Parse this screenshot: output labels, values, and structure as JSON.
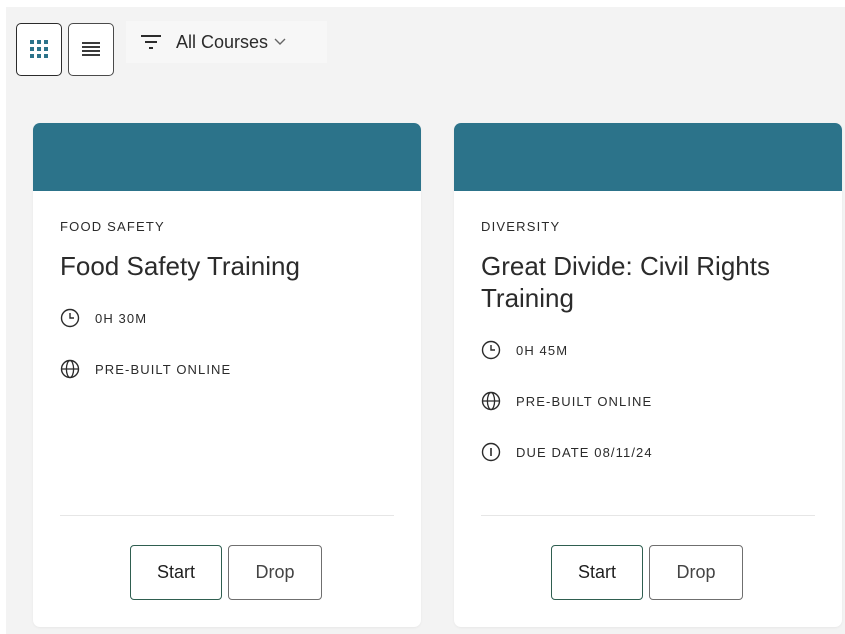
{
  "toolbar": {
    "grid_view_icon": "grid-dots-icon",
    "list_view_icon": "list-lines-icon",
    "filter": {
      "icon": "filter-icon",
      "label": "All Courses",
      "chevron_icon": "chevron-down-icon"
    }
  },
  "colors": {
    "banner": "#2c738a",
    "background": "#f3f3f3",
    "card": "#ffffff",
    "start_border": "#2f5e50"
  },
  "courses": [
    {
      "category": "FOOD SAFETY",
      "title": "Food Safety Training",
      "duration": "0H 30M",
      "format": "PRE-BUILT ONLINE",
      "start_label": "Start",
      "drop_label": "Drop"
    },
    {
      "category": "DIVERSITY",
      "title": "Great Divide: Civil Rights Training",
      "duration": "0H 45M",
      "format": "PRE-BUILT ONLINE",
      "due": "DUE DATE 08/11/24",
      "start_label": "Start",
      "drop_label": "Drop"
    }
  ]
}
